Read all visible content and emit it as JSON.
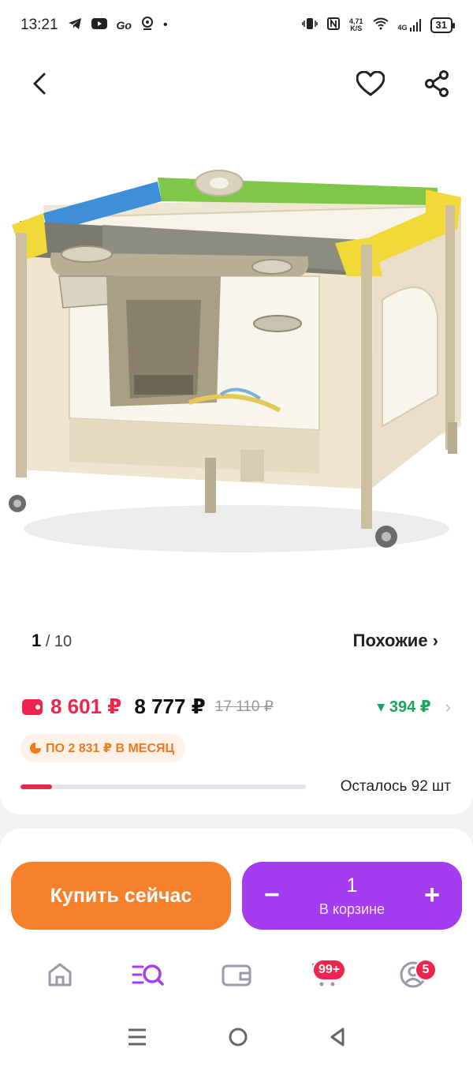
{
  "status_bar": {
    "time": "13:21",
    "net_speed_value": "4,71",
    "net_speed_unit": "K/S",
    "network_type": "4G",
    "battery": "31"
  },
  "gallery": {
    "current": "1",
    "total": "/ 10",
    "similar_label": "Похожие ›"
  },
  "price": {
    "wallet_price": "8 601 ₽",
    "price": "8 777 ₽",
    "old_price": "17 110 ₽",
    "discount": "▾ 394 ₽",
    "installment": "ПО 2 831 ₽ В МЕСЯЦ",
    "stock_text": "Осталось 92 шт",
    "stock_level": 0.11
  },
  "actions": {
    "buy_label": "Купить сейчас",
    "cart_qty": "1",
    "cart_label": "В корзине",
    "minus": "−",
    "plus": "+"
  },
  "tabbar": {
    "cart_badge": "99+",
    "profile_badge": "5"
  },
  "colors": {
    "accent_red": "#f0254d",
    "buy_orange": "#f7812b",
    "cart_purple": "#a43cf0",
    "discount_green": "#1aa55c"
  }
}
